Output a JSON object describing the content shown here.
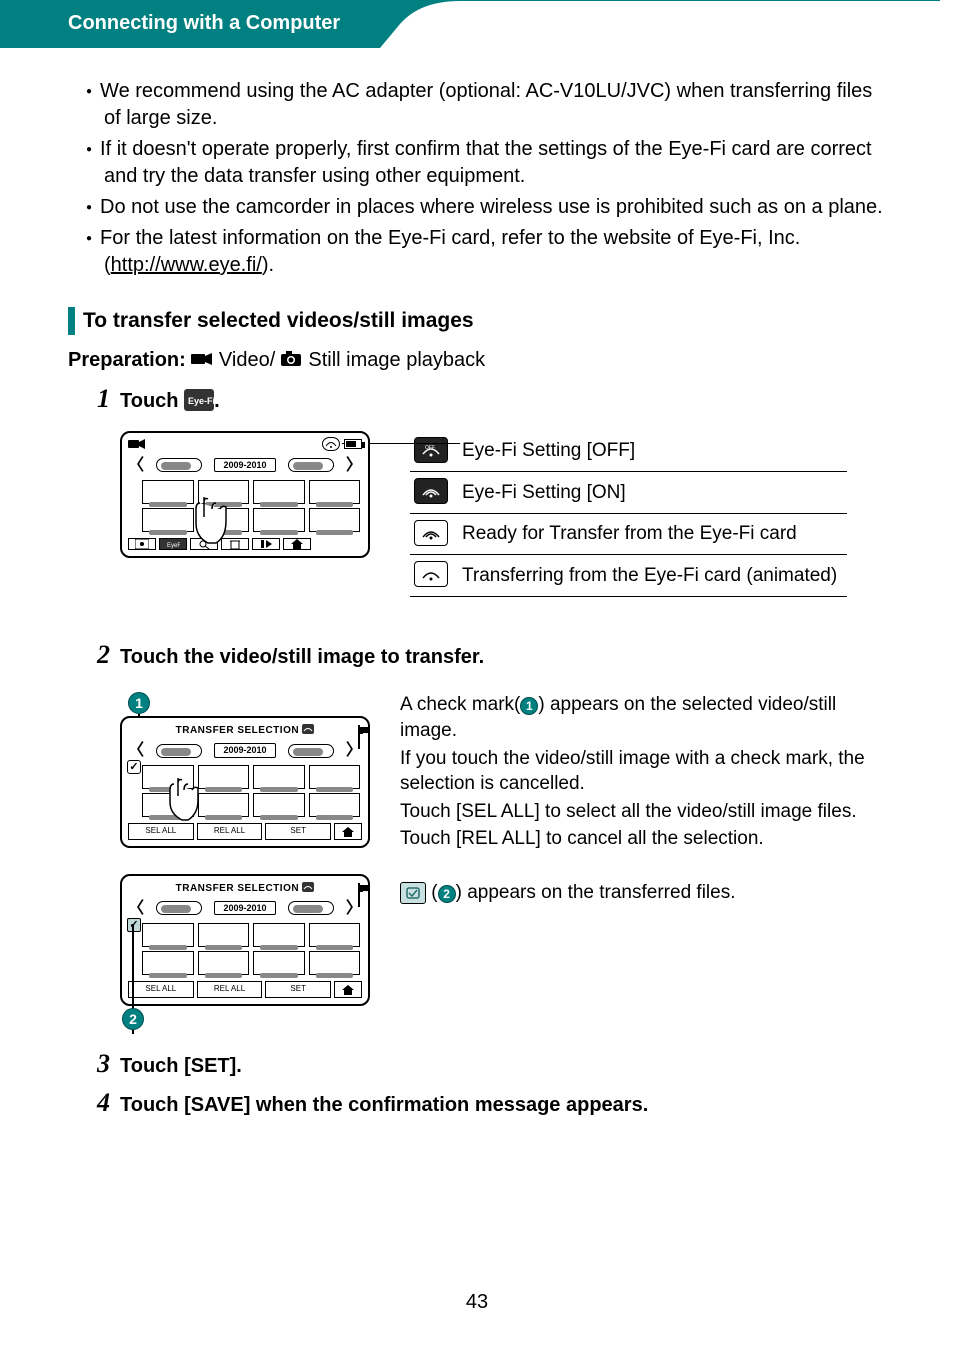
{
  "header": {
    "title": "Connecting with a Computer"
  },
  "bullets": [
    "We recommend using the AC adapter (optional: AC-V10LU/JVC) when transferring files of large size.",
    "If it doesn't operate properly, first confirm that the settings of the Eye-Fi card are correct and try the data transfer using other equipment.",
    "Do not use the camcorder in places where wireless use is prohibited such as on a plane.",
    "For the latest information on the Eye-Fi card, refer to the website of Eye-Fi, Inc. "
  ],
  "eye_fi_url_text": "http://www.eye.fi/",
  "section_heading": "To transfer selected videos/still images",
  "preparation": {
    "label": "Preparation:",
    "video_text": " Video/ ",
    "still_text": " Still image playback"
  },
  "steps": {
    "s1": {
      "num": "1",
      "text": "Touch ",
      "icon_label": "Eye-Fi",
      "period": "."
    },
    "s2": {
      "num": "2",
      "text": "Touch the video/still image to transfer."
    },
    "s3": {
      "num": "3",
      "text": "Touch [SET]."
    },
    "s4": {
      "num": "4",
      "text": "Touch [SAVE] when the confirmation message appears."
    }
  },
  "cam": {
    "year": "2009-2010",
    "title": "TRANSFER SELECTION",
    "sel_all": "SEL ALL",
    "rel_all": "REL ALL",
    "set": "SET"
  },
  "legend": {
    "off": "Eye-Fi Setting [OFF]",
    "on": "Eye-Fi Setting [ON]",
    "ready": "Ready for Transfer from the Eye-Fi card",
    "transferring": "Transferring from the Eye-Fi card (animated)"
  },
  "step2_desc": {
    "p1a": "A check mark(",
    "p1b": ") appears on the selected video/still image.",
    "p2": "If you touch the video/still image with a check mark, the selection is cancelled.",
    "p3": "Touch [SEL ALL] to select all the video/still image files.",
    "p4": "Touch [REL ALL] to cancel all the selection."
  },
  "transferred": {
    "a": " (",
    "b": ") appears on the transferred files."
  },
  "markers": {
    "one": "1",
    "two": "2"
  },
  "page_num": "43"
}
